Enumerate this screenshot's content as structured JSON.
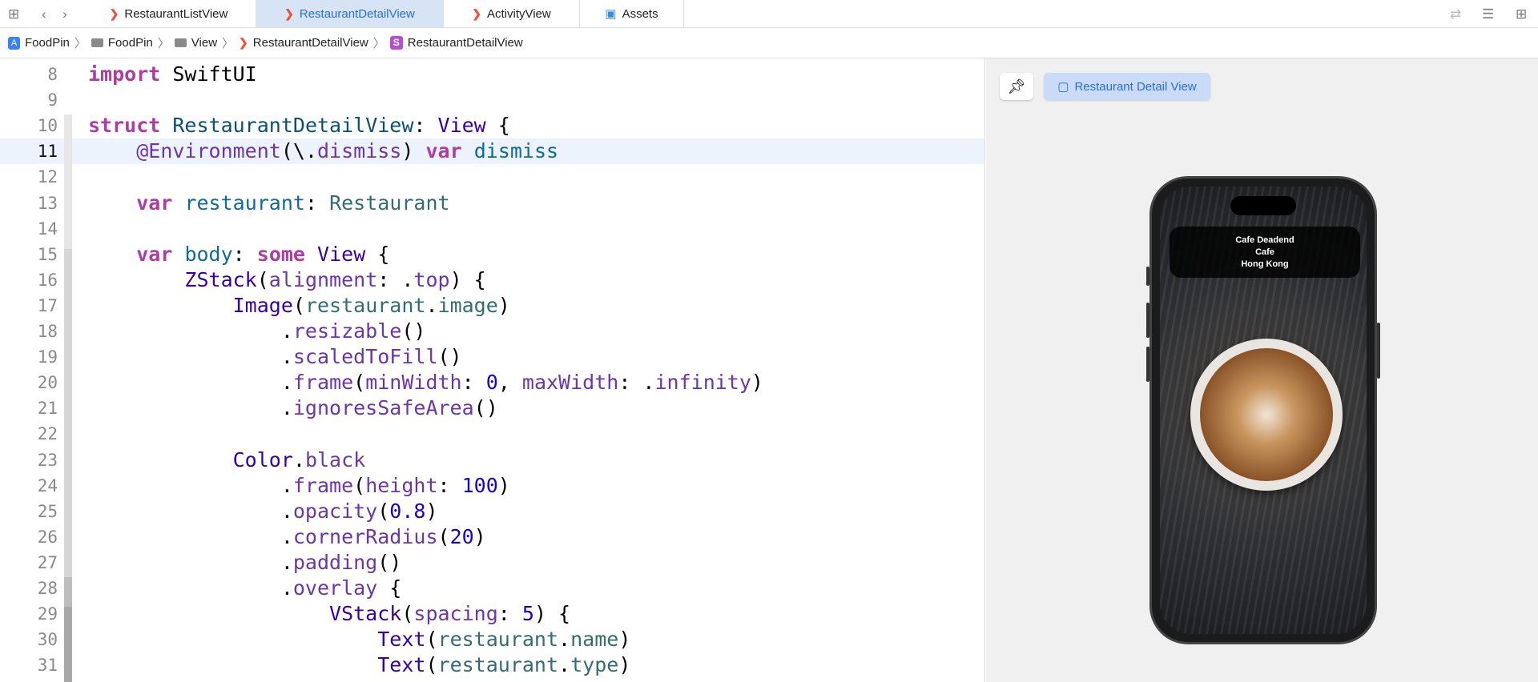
{
  "tabs": [
    {
      "label": "RestaurantListView",
      "icon": "swift-icon",
      "active": false
    },
    {
      "label": "RestaurantDetailView",
      "icon": "swift-icon",
      "active": true
    },
    {
      "label": "ActivityView",
      "icon": "swift-icon",
      "active": false
    },
    {
      "label": "Assets",
      "icon": "assets-icon",
      "active": false
    }
  ],
  "breadcrumb": [
    "FoodPin",
    "FoodPin",
    "View",
    "RestaurantDetailView",
    "RestaurantDetailView"
  ],
  "editor": {
    "current_line": 11,
    "lines": [
      {
        "n": 8,
        "tokens": [
          [
            "import",
            "kw"
          ],
          [
            " SwiftUI",
            ""
          ]
        ]
      },
      {
        "n": 9,
        "tokens": []
      },
      {
        "n": 10,
        "tokens": [
          [
            "struct",
            "kw"
          ],
          [
            " ",
            ""
          ],
          [
            "RestaurantDetailView",
            "decl"
          ],
          [
            ": ",
            ""
          ],
          [
            "View",
            "ty"
          ],
          [
            " {",
            ""
          ]
        ]
      },
      {
        "n": 11,
        "tokens": [
          [
            "    ",
            ""
          ],
          [
            "@Environment",
            "attr"
          ],
          [
            "(\\.",
            ""
          ],
          [
            "dismiss",
            "fn"
          ],
          [
            ") ",
            ""
          ],
          [
            "var",
            "kw"
          ],
          [
            " ",
            ""
          ],
          [
            "dismiss",
            "vdecl"
          ]
        ]
      },
      {
        "n": 12,
        "tokens": []
      },
      {
        "n": 13,
        "tokens": [
          [
            "    ",
            ""
          ],
          [
            "var",
            "kw"
          ],
          [
            " ",
            ""
          ],
          [
            "restaurant",
            "vdecl"
          ],
          [
            ": ",
            ""
          ],
          [
            "Restaurant",
            "prop"
          ]
        ]
      },
      {
        "n": 14,
        "tokens": []
      },
      {
        "n": 15,
        "tokens": [
          [
            "    ",
            ""
          ],
          [
            "var",
            "kw"
          ],
          [
            " ",
            ""
          ],
          [
            "body",
            "vdecl"
          ],
          [
            ": ",
            ""
          ],
          [
            "some",
            "kw"
          ],
          [
            " ",
            ""
          ],
          [
            "View",
            "ty"
          ],
          [
            " {",
            ""
          ]
        ]
      },
      {
        "n": 16,
        "tokens": [
          [
            "        ",
            ""
          ],
          [
            "ZStack",
            "ty"
          ],
          [
            "(",
            ""
          ],
          [
            "alignment",
            "fn"
          ],
          [
            ": .",
            ""
          ],
          [
            "top",
            "fn"
          ],
          [
            ") {",
            ""
          ]
        ]
      },
      {
        "n": 17,
        "tokens": [
          [
            "            ",
            ""
          ],
          [
            "Image",
            "ty"
          ],
          [
            "(",
            ""
          ],
          [
            "restaurant",
            "prop"
          ],
          [
            ".",
            ""
          ],
          [
            "image",
            "prop"
          ],
          [
            ")",
            ""
          ]
        ]
      },
      {
        "n": 18,
        "tokens": [
          [
            "                .",
            ""
          ],
          [
            "resizable",
            "fn"
          ],
          [
            "()",
            ""
          ]
        ]
      },
      {
        "n": 19,
        "tokens": [
          [
            "                .",
            ""
          ],
          [
            "scaledToFill",
            "fn"
          ],
          [
            "()",
            ""
          ]
        ]
      },
      {
        "n": 20,
        "tokens": [
          [
            "                .",
            ""
          ],
          [
            "frame",
            "fn"
          ],
          [
            "(",
            ""
          ],
          [
            "minWidth",
            "fn"
          ],
          [
            ": ",
            ""
          ],
          [
            "0",
            "num"
          ],
          [
            ", ",
            ""
          ],
          [
            "maxWidth",
            "fn"
          ],
          [
            ": .",
            ""
          ],
          [
            "infinity",
            "fn"
          ],
          [
            ")",
            ""
          ]
        ]
      },
      {
        "n": 21,
        "tokens": [
          [
            "                .",
            ""
          ],
          [
            "ignoresSafeArea",
            "fn"
          ],
          [
            "()",
            ""
          ]
        ]
      },
      {
        "n": 22,
        "tokens": []
      },
      {
        "n": 23,
        "tokens": [
          [
            "            ",
            ""
          ],
          [
            "Color",
            "ty"
          ],
          [
            ".",
            ""
          ],
          [
            "black",
            "fn"
          ]
        ]
      },
      {
        "n": 24,
        "tokens": [
          [
            "                .",
            ""
          ],
          [
            "frame",
            "fn"
          ],
          [
            "(",
            ""
          ],
          [
            "height",
            "fn"
          ],
          [
            ": ",
            ""
          ],
          [
            "100",
            "num"
          ],
          [
            ")",
            ""
          ]
        ]
      },
      {
        "n": 25,
        "tokens": [
          [
            "                .",
            ""
          ],
          [
            "opacity",
            "fn"
          ],
          [
            "(",
            ""
          ],
          [
            "0.8",
            "num"
          ],
          [
            ")",
            ""
          ]
        ]
      },
      {
        "n": 26,
        "tokens": [
          [
            "                .",
            ""
          ],
          [
            "cornerRadius",
            "fn"
          ],
          [
            "(",
            ""
          ],
          [
            "20",
            "num"
          ],
          [
            ")",
            ""
          ]
        ]
      },
      {
        "n": 27,
        "tokens": [
          [
            "                .",
            ""
          ],
          [
            "padding",
            "fn"
          ],
          [
            "()",
            ""
          ]
        ]
      },
      {
        "n": 28,
        "tokens": [
          [
            "                .",
            ""
          ],
          [
            "overlay",
            "fn"
          ],
          [
            " {",
            ""
          ]
        ]
      },
      {
        "n": 29,
        "tokens": [
          [
            "                    ",
            ""
          ],
          [
            "VStack",
            "ty"
          ],
          [
            "(",
            ""
          ],
          [
            "spacing",
            "fn"
          ],
          [
            ": ",
            ""
          ],
          [
            "5",
            "num"
          ],
          [
            ") {",
            ""
          ]
        ]
      },
      {
        "n": 30,
        "tokens": [
          [
            "                        ",
            ""
          ],
          [
            "Text",
            "ty"
          ],
          [
            "(",
            ""
          ],
          [
            "restaurant",
            "prop"
          ],
          [
            ".",
            ""
          ],
          [
            "name",
            "prop"
          ],
          [
            ")",
            ""
          ]
        ]
      },
      {
        "n": 31,
        "tokens": [
          [
            "                        ",
            ""
          ],
          [
            "Text",
            "ty"
          ],
          [
            "(",
            ""
          ],
          [
            "restaurant",
            "prop"
          ],
          [
            ".",
            ""
          ],
          [
            "type",
            "prop"
          ],
          [
            ")",
            ""
          ]
        ]
      }
    ]
  },
  "preview": {
    "chip_label": "Restaurant Detail View",
    "restaurant": {
      "name": "Cafe Deadend",
      "type": "Cafe",
      "location": "Hong Kong"
    }
  }
}
